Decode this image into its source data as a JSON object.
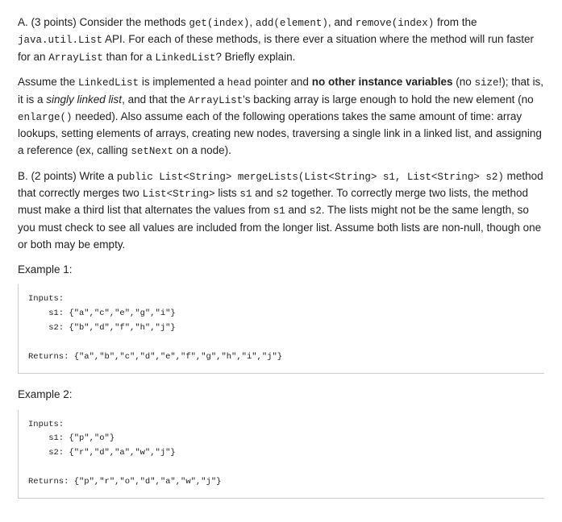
{
  "partA": {
    "prefix": "A. (3 points) Consider the methods ",
    "m1": "get(index)",
    "sep1": ", ",
    "m2": "add(element)",
    "sep2": ", and ",
    "m3": "remove(index)",
    "afterMethods": " from the ",
    "api": "java.util.List",
    "afterApi": " API. For each of these methods, is there ever a situation where the method will run faster for an ",
    "al": "ArrayList",
    "sep3": " than for a ",
    "ll": "LinkedList",
    "tail": "? Briefly explain."
  },
  "assume": {
    "t1": "Assume the ",
    "ll": "LinkedList",
    "t2": " is implemented a ",
    "head": "head",
    "t3": " pointer and ",
    "bold": "no other instance variables",
    "t4": " (no ",
    "size": "size",
    "t5": "!); that is, it is a ",
    "singly": "singly linked list",
    "t6": ", and that the ",
    "al": "ArrayList",
    "t7": "'s backing array is large enough to hold the new element (no ",
    "enlarge": "enlarge()",
    "t8": " needed). Also assume each of the following operations takes the same amount of time: array lookups, setting elements of arrays, creating new nodes, traversing a single link in a linked list, and assigning a reference (ex, calling ",
    "setnext": "setNext",
    "t9": " on a node)."
  },
  "partB": {
    "t1": "B. (2 points) Write a ",
    "sig": "public List<String> mergeLists(List<String> s1, List<String> s2)",
    "t2": " method that correctly merges two ",
    "ls": "List<String>",
    "t3": " lists ",
    "s1a": "s1",
    "t4": " and ",
    "s2a": "s2",
    "t5": " together. To correctly merge two lists, the method must make a third list that alternates the values from ",
    "s1b": "s1",
    "t6": " and ",
    "s2b": "s2",
    "t7": ". The lists might not be the same length, so you must check to see all values are included from the longer list. Assume both lists are non-null, though one or both may be empty."
  },
  "ex1": {
    "label": "Example 1:",
    "code": "Inputs:\n    s1: {\"a\",\"c\",\"e\",\"g\",\"i\"}\n    s2: {\"b\",\"d\",\"f\",\"h\",\"j\"}\n\nReturns: {\"a\",\"b\",\"c\",\"d\",\"e\",\"f\",\"g\",\"h\",\"i\",\"j\"}"
  },
  "ex2": {
    "label": "Example 2:",
    "code": "Inputs:\n    s1: {\"p\",\"o\"}\n    s2: {\"r\",\"d\",\"a\",\"w\",\"j\"}\n\nReturns: {\"p\",\"r\",\"o\",\"d\",\"a\",\"w\",\"j\"}"
  }
}
